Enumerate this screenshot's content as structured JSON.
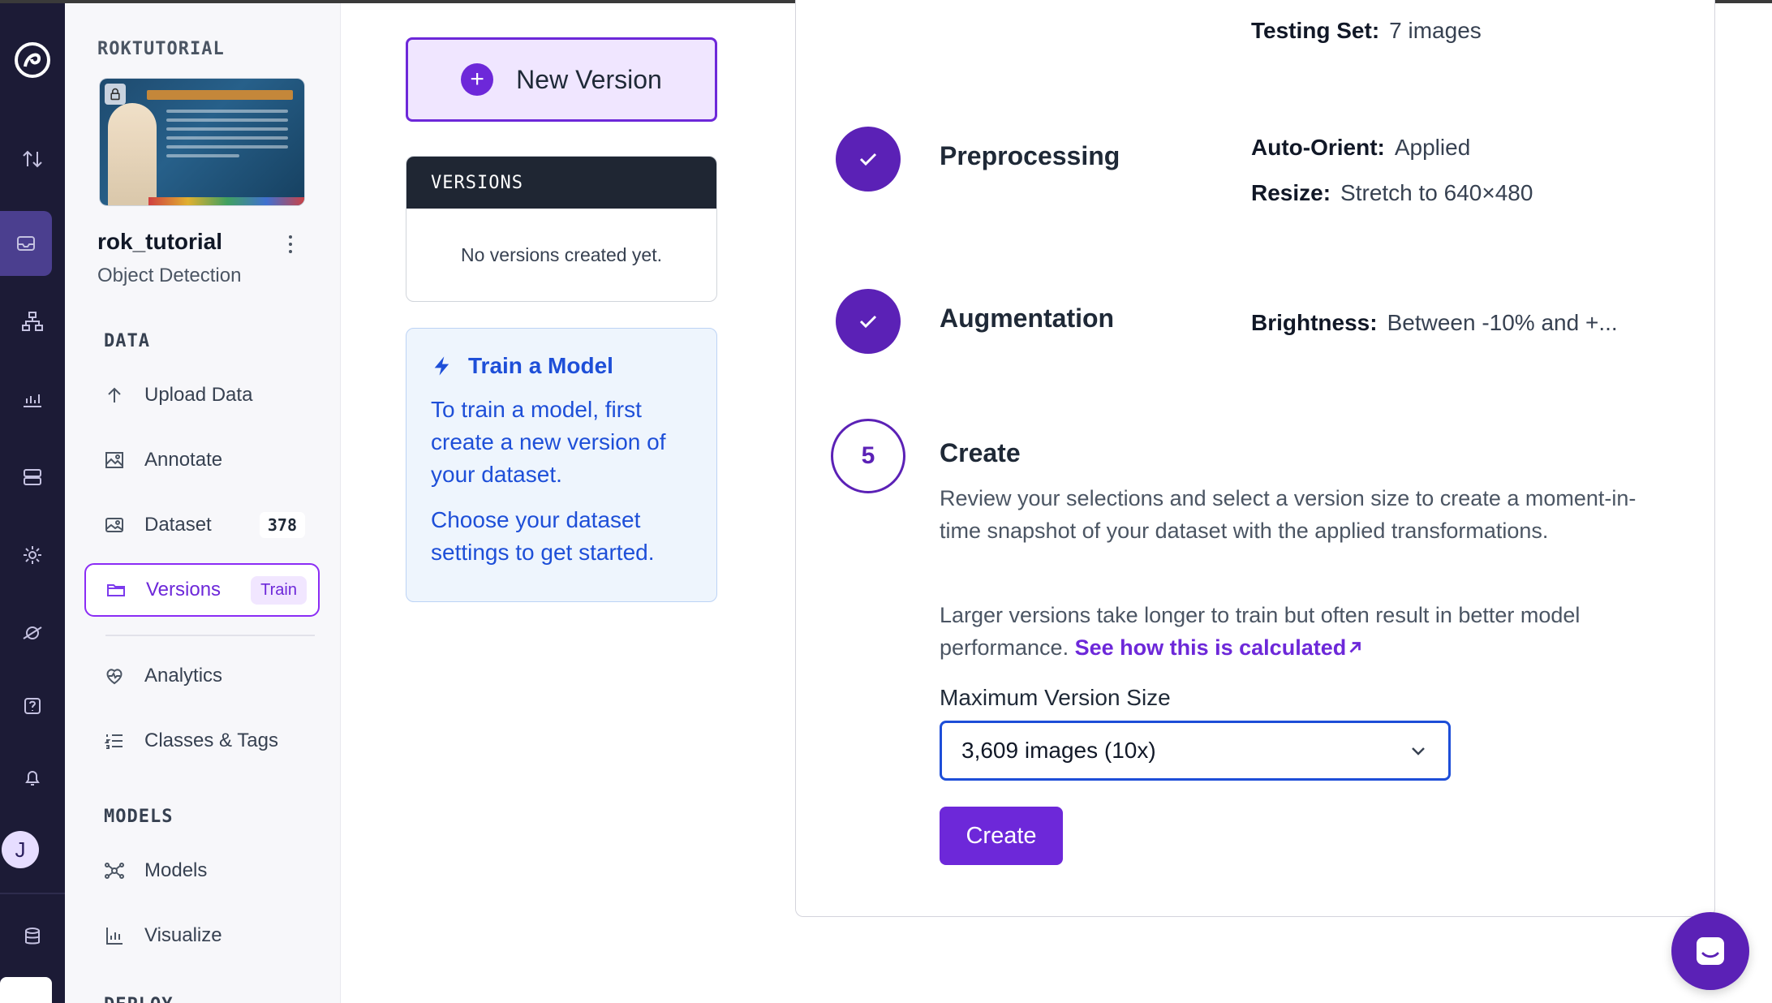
{
  "workspace": {
    "name": "ROKTUTORIAL"
  },
  "project": {
    "name": "rok_tutorial",
    "type": "Object Detection"
  },
  "sidebar": {
    "sections": {
      "data": "DATA",
      "models": "MODELS",
      "deploy": "DEPLOY"
    },
    "items": [
      {
        "label": "Upload Data",
        "icon": "upload-arrow-icon"
      },
      {
        "label": "Annotate",
        "icon": "annotate-image-icon"
      },
      {
        "label": "Dataset",
        "icon": "image-gallery-icon",
        "count": "378"
      },
      {
        "label": "Versions",
        "icon": "folder-icon",
        "badge": "Train",
        "active": true
      },
      {
        "label": "Analytics",
        "icon": "heart-pulse-icon"
      },
      {
        "label": "Classes & Tags",
        "icon": "list-numbered-icon"
      },
      {
        "label": "Models",
        "icon": "model-network-icon"
      },
      {
        "label": "Visualize",
        "icon": "bar-chart-icon"
      }
    ]
  },
  "rail": {
    "icons": [
      "logo-icon",
      "sort-arrows-icon",
      "inbox-icon",
      "hierarchy-icon",
      "chart-icon",
      "server-icon",
      "gear-icon",
      "satellite-icon",
      "help-icon",
      "bell-icon",
      "database-icon"
    ],
    "avatar_initial": "J"
  },
  "versions_panel": {
    "new_version_label": "New Version",
    "header": "VERSIONS",
    "empty_text": "No versions created yet."
  },
  "train_card": {
    "title": "Train a Model",
    "line1": "To train a model, first create a new version of your dataset.",
    "line2": "Choose your dataset settings to get started."
  },
  "generate": {
    "testing_set": {
      "key": "Testing Set:",
      "value": "7 images"
    },
    "preprocessing": {
      "title": "Preprocessing",
      "auto_orient": {
        "key": "Auto-Orient:",
        "value": "Applied"
      },
      "resize": {
        "key": "Resize:",
        "value": "Stretch to 640×480"
      }
    },
    "augmentation": {
      "title": "Augmentation",
      "brightness": {
        "key": "Brightness:",
        "value": "Between -10% and +..."
      }
    },
    "create": {
      "step_number": "5",
      "title": "Create",
      "description": "Review your selections and select a version size to create a moment-in-time snapshot of your dataset with the applied transformations.",
      "note": "Larger versions take longer to train but often result in better model performance.",
      "link_text": "See how this is calculated",
      "size_label": "Maximum Version Size",
      "size_value": "3,609 images (10x)",
      "button_label": "Create"
    }
  },
  "colors": {
    "accent": "#6d28d9",
    "rail_bg": "#1c1b36",
    "info_blue": "#1e4fd8"
  }
}
